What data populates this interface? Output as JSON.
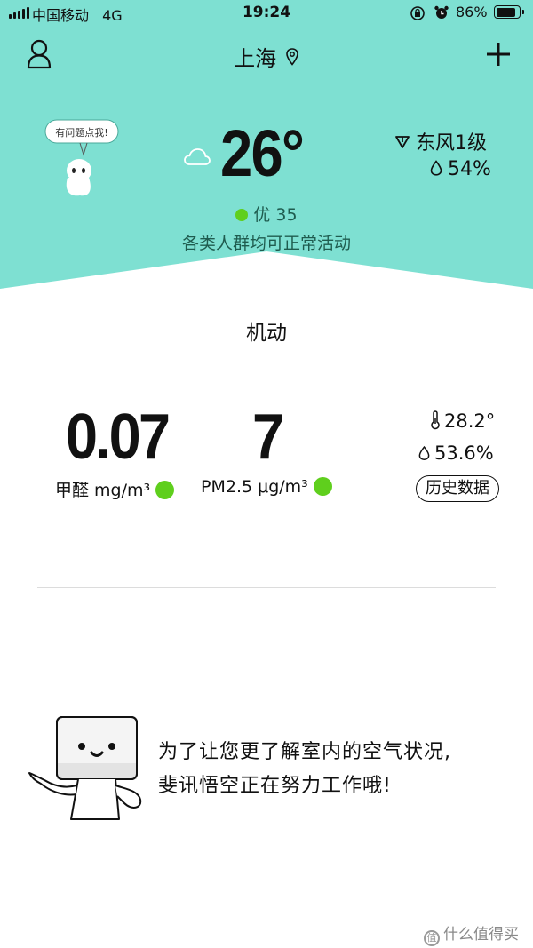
{
  "status_bar": {
    "carrier": "中国移动",
    "network": "4G",
    "time": "19:24",
    "battery": "86%",
    "battery_level": 0.86
  },
  "nav": {
    "city": "上海",
    "profile_icon": "user-icon",
    "location_icon": "location-pin-icon",
    "add_icon": "plus-icon"
  },
  "weather": {
    "bubble_text": "有问题点我!",
    "condition_icon": "cloud-icon",
    "temperature": "26°",
    "wind": "东风1级",
    "humidity": "54%",
    "aqi_label": "优 35",
    "aqi_color": "#5fcf1d",
    "advice": "各类人群均可正常活动"
  },
  "device": {
    "name": "机动",
    "formaldehyde_value": "0.07",
    "formaldehyde_label": "甲醛 mg/m³",
    "pm25_value": "7",
    "pm25_label": "PM2.5 μg/m³",
    "indoor_temp": "28.2°",
    "indoor_humidity": "53.6%",
    "history_button": "历史数据",
    "status_color": "#5fcf1d"
  },
  "message": {
    "line1": "为了让您更了解室内的空气状况,",
    "line2": "斐讯悟空正在努力工作哦!"
  },
  "watermark": {
    "badge": "值",
    "text": "什么值得买"
  },
  "colors": {
    "header_bg": "#7ee0d2",
    "accent_text": "#1f5c4f"
  }
}
